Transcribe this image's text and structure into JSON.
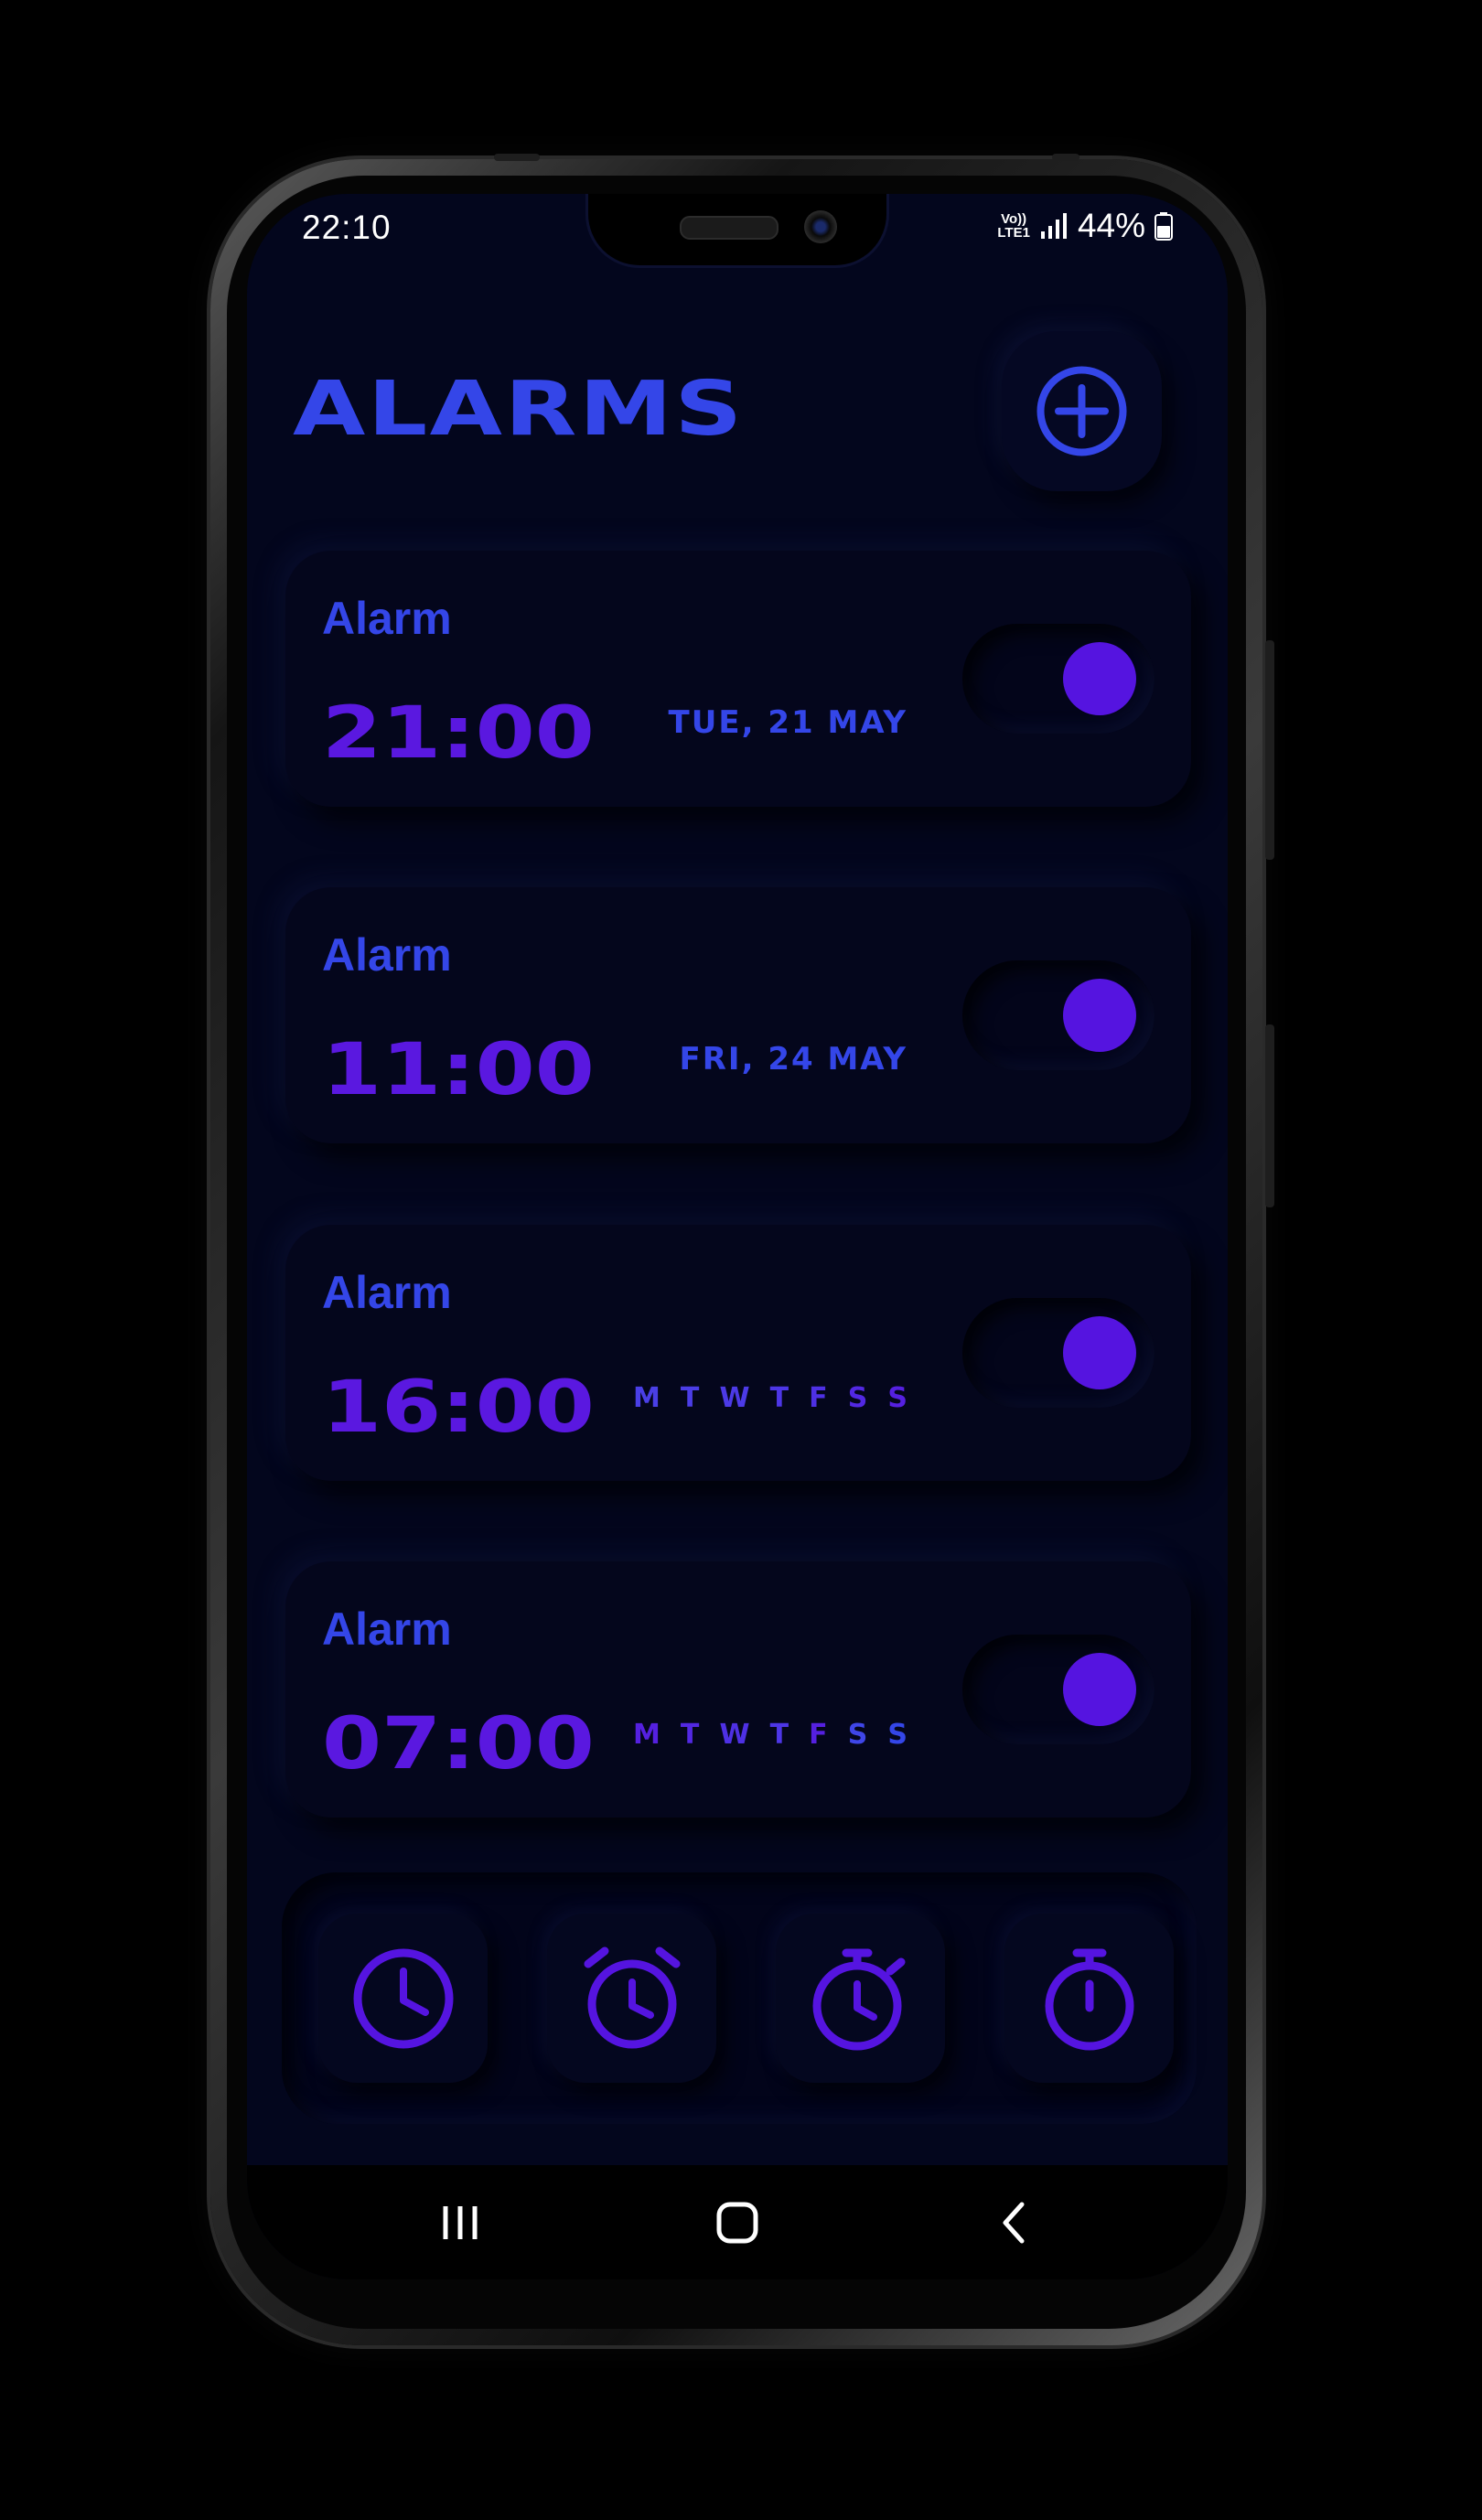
{
  "status_bar": {
    "time": "22:10",
    "volte": "Vo))",
    "lte": "LTE1",
    "battery": "44%"
  },
  "header": {
    "title": "ALARMS",
    "add_icon": "plus-circle-icon"
  },
  "alarms": [
    {
      "label": "Alarm",
      "time": "21:00",
      "date": "TUE,  21  MAY",
      "enabled": true
    },
    {
      "label": "Alarm",
      "time": "11:00",
      "date": "FRI,  24  MAY",
      "enabled": true
    },
    {
      "label": "Alarm",
      "time": "16:00",
      "days": [
        "M",
        "T",
        "W",
        "T",
        "F",
        "S",
        "S"
      ],
      "enabled": true
    },
    {
      "label": "Alarm",
      "time": "07:00",
      "days": [
        "M",
        "T",
        "W",
        "T",
        "F",
        "S",
        "S"
      ],
      "enabled": true
    }
  ],
  "bottom_nav": [
    {
      "icon": "clock-icon"
    },
    {
      "icon": "alarm-clock-icon"
    },
    {
      "icon": "stopwatch-icon"
    },
    {
      "icon": "timer-icon"
    }
  ],
  "system_nav": {
    "recents_icon": "recents-icon",
    "home_icon": "home-icon",
    "back_icon": "back-icon"
  },
  "colors": {
    "background": "#03061d",
    "accent_blue": "#3446e8",
    "accent_purple": "#5514e0"
  }
}
